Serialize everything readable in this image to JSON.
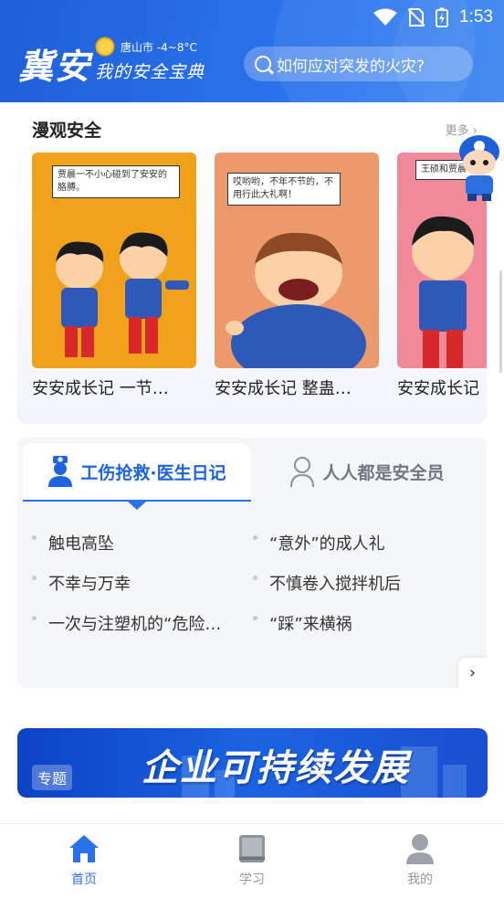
{
  "status": {
    "time": "1:53"
  },
  "header": {
    "logo": "冀安",
    "weather": "唐山市 -4~8°C",
    "slogan": "我的安全宝典",
    "search_placeholder": "如何应对突发的火灾?"
  },
  "comic": {
    "title": "漫观安全",
    "more": "更多 ›",
    "cards": [
      {
        "caption": "安安成长记 一节…",
        "bubble": "贾晨一不小心碰到了安安的胳膊。"
      },
      {
        "caption": "安安成长记 整蛊…",
        "bubble": "哎哟哟，不年不节的，不用行此大礼啊！"
      },
      {
        "caption": "安安成长记",
        "bubble": "王硕和贾晨"
      }
    ]
  },
  "tabs": {
    "active": "工伤抢救·医生日记",
    "inactive": "人人都是安全员",
    "items": [
      "触电高坠",
      "“意外”的成人礼",
      "不幸与万幸",
      "不慎卷入搅拌机后",
      "一次与注塑机的“危险…",
      "“踩”来横祸"
    ],
    "next": "›"
  },
  "banner": {
    "title": "企业可持续发展",
    "tag": "专题"
  },
  "nav": {
    "home": "首页",
    "study": "学习",
    "mine": "我的"
  },
  "colors": {
    "primary": "#2a72ea",
    "header": "#1f5fd8"
  }
}
